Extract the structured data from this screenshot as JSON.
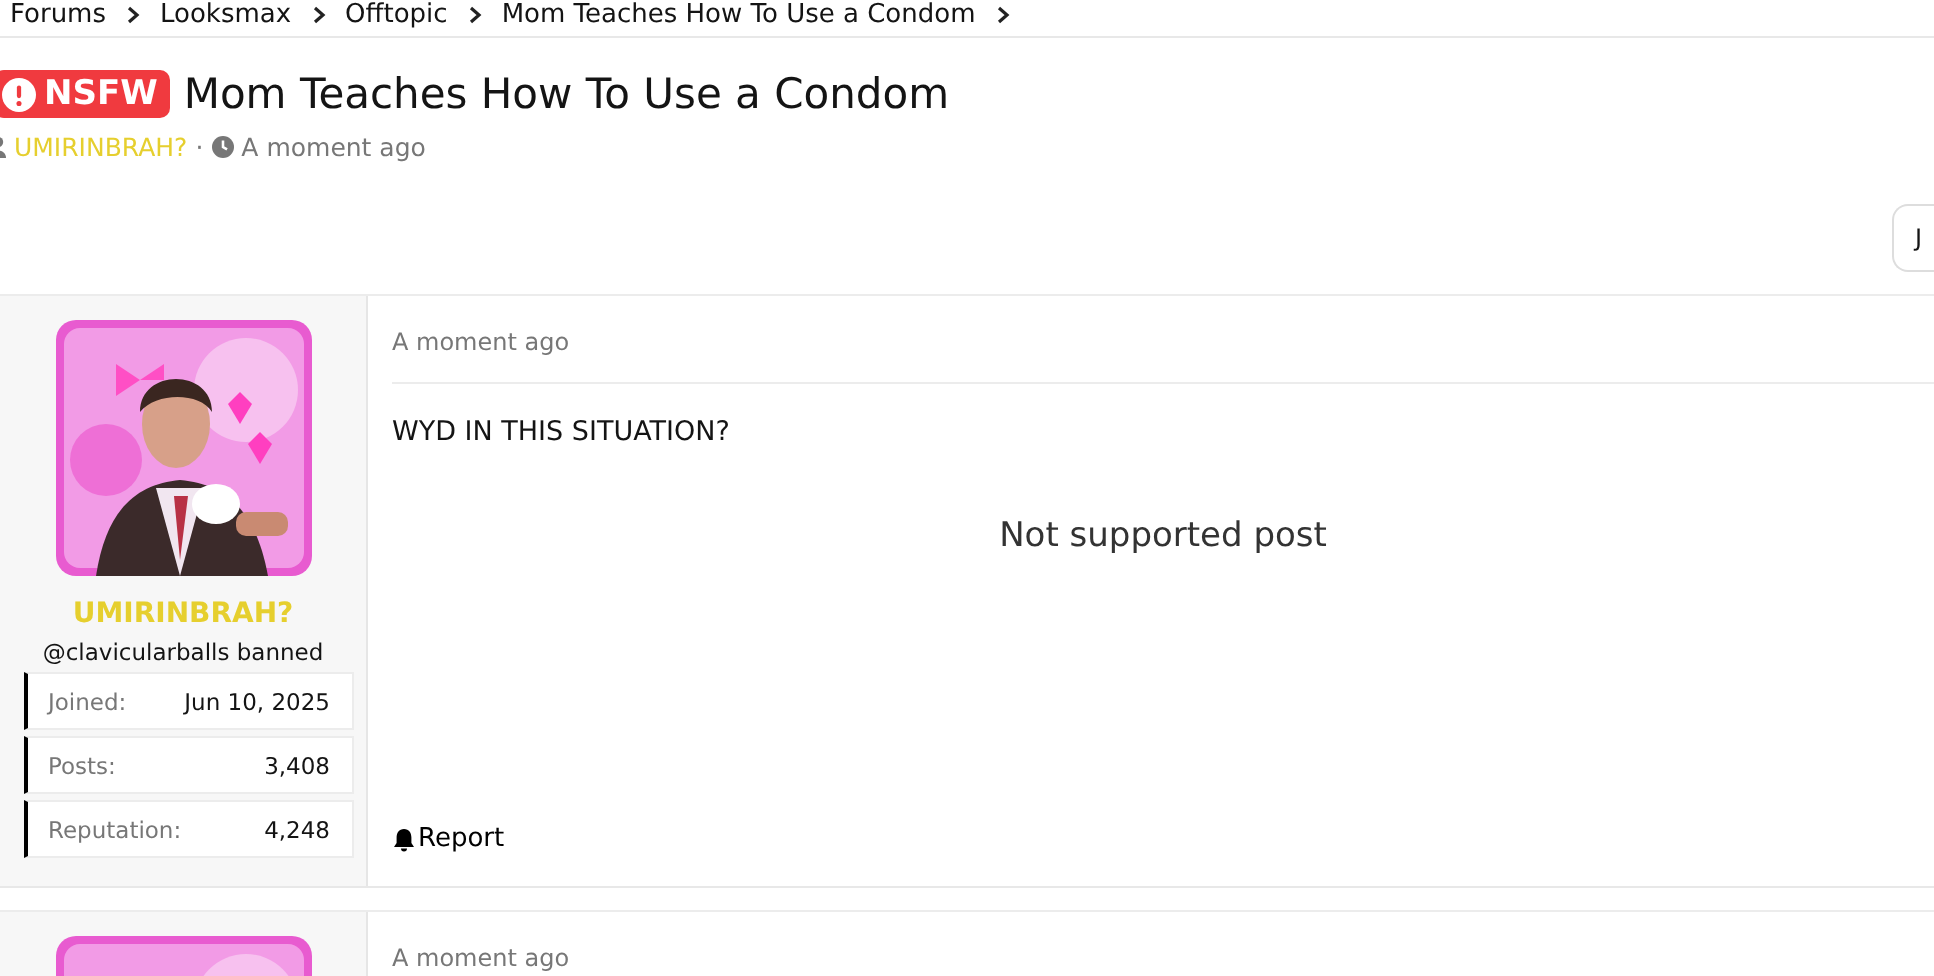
{
  "breadcrumbs": [
    {
      "label": "Forums"
    },
    {
      "label": "Looksmax"
    },
    {
      "label": "Offtopic"
    },
    {
      "label": "Mom Teaches How To Use a Condom"
    }
  ],
  "thread": {
    "badge": "NSFW",
    "title": "Mom Teaches How To Use a Condom",
    "author": "UMIRINBRAH?",
    "separator": "·",
    "time": "A moment ago"
  },
  "action_button": {
    "label": "J"
  },
  "posts": [
    {
      "avatar": {
        "kind": "picture"
      },
      "username": "UMIRINBRAH?",
      "subtitle": "@clavicularballs banned",
      "stats": [
        {
          "label": "Joined:",
          "value": "Jun 10, 2025"
        },
        {
          "label": "Posts:",
          "value": "3,408"
        },
        {
          "label": "Reputation:",
          "value": "4,248"
        }
      ],
      "time": "A moment ago",
      "body": "WYD IN THIS SITUATION?",
      "embed": "Not supported post",
      "report": "Report"
    },
    {
      "avatar": {
        "kind": "picture"
      },
      "time": "A moment ago"
    }
  ]
}
